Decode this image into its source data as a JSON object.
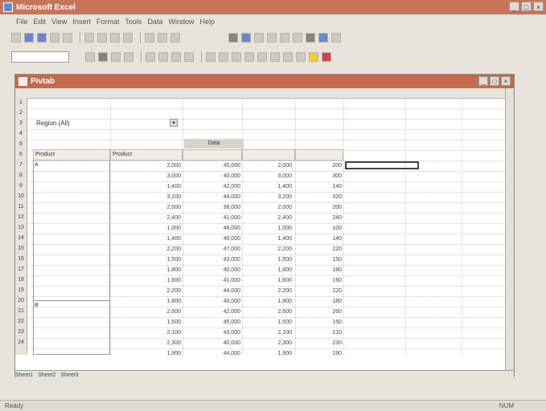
{
  "window": {
    "title": "Microsoft Excel"
  },
  "menu": [
    "File",
    "Edit",
    "View",
    "Insert",
    "Format",
    "Tools",
    "Data",
    "Window",
    "Help"
  ],
  "workbook": {
    "title": "Pivtab"
  },
  "sheet": {
    "row_numbers": [
      "1",
      "2",
      "3",
      "4",
      "5",
      "6",
      "7",
      "8",
      "9",
      "10",
      "11",
      "12",
      "13",
      "14",
      "15",
      "16",
      "17",
      "18",
      "19",
      "20",
      "21",
      "22",
      "23",
      "24"
    ],
    "page_field": "Region (All)",
    "data_header": "Data",
    "headers": [
      "Product",
      "Product",
      "",
      "",
      ""
    ],
    "groups": [
      "A",
      "B"
    ],
    "values": {
      "col1": [
        "2,000",
        "3,000",
        "1,400",
        "3,200",
        "2,000",
        "2,400",
        "1,000",
        "1,400",
        "2,200",
        "1,500",
        "1,800",
        "1,600",
        "2,200",
        "1,800",
        "2,600",
        "1,500",
        "2,100",
        "2,300",
        "1,900"
      ],
      "col2": [
        "45,000",
        "40,000",
        "42,000",
        "44,000",
        "38,000",
        "41,000",
        "46,000",
        "40,000",
        "47,000",
        "43,000",
        "40,000",
        "41,000",
        "44,000",
        "40,000",
        "42,000",
        "45,000",
        "43,000",
        "40,000",
        "44,000"
      ],
      "col3": [
        "2,000",
        "3,000",
        "1,400",
        "3,200",
        "2,000",
        "2,400",
        "1,000",
        "1,400",
        "2,200",
        "1,500",
        "1,800",
        "1,600",
        "2,200",
        "1,800",
        "2,600",
        "1,500",
        "2,100",
        "2,300",
        "1,900"
      ],
      "col4": [
        "200",
        "300",
        "140",
        "320",
        "200",
        "240",
        "100",
        "140",
        "220",
        "150",
        "180",
        "160",
        "220",
        "180",
        "260",
        "150",
        "210",
        "230",
        "190"
      ]
    },
    "tabs": [
      "Sheet1",
      "Sheet2",
      "Sheet3"
    ]
  },
  "status": {
    "left": "Ready",
    "right": "NUM"
  }
}
